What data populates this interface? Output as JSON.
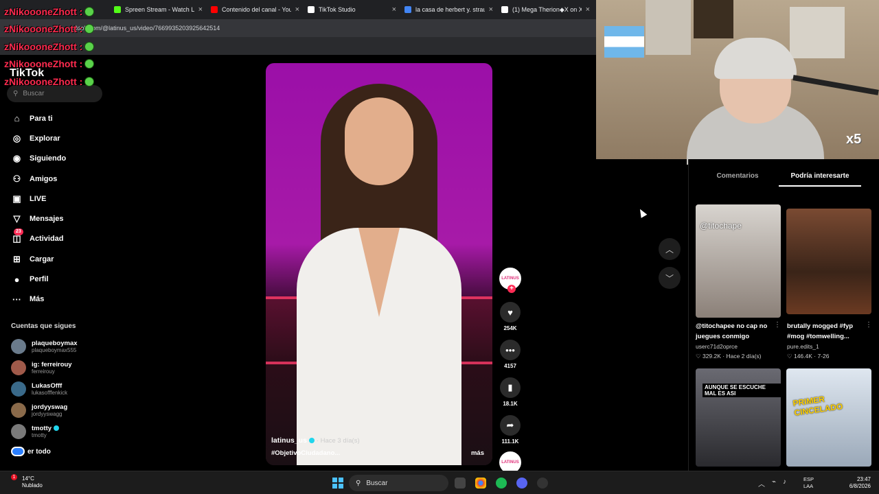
{
  "browser": {
    "tabs": [
      {
        "title": "Spreen Stream - Watch Li",
        "color": "#53fc18"
      },
      {
        "title": "Contenido del canal - You",
        "color": "#ff0000"
      },
      {
        "title": "TikTok Studio",
        "color": "#ffffff"
      },
      {
        "title": "la casa de herbert y. straus",
        "color": "#4285f4"
      },
      {
        "title": "(1) Mega Therion◆X on X",
        "color": "#ffffff"
      }
    ],
    "url": "tiktok.com/@latinus_us/video/7669935203925642514"
  },
  "chat_overlay": {
    "username": "zNikoooneZhott",
    "lines": [
      "zNikoooneZhott :",
      "zNikoooneZhott :",
      "zNikoooneZhott :",
      "zNikoooneZhott :",
      "zNikoooneZhott :"
    ]
  },
  "sidebar": {
    "logo": "TikTok",
    "search_placeholder": "Buscar",
    "nav": [
      {
        "label": "Para ti",
        "icon": "home-icon",
        "glyph": "⌂"
      },
      {
        "label": "Explorar",
        "icon": "compass-icon",
        "glyph": "◎"
      },
      {
        "label": "Siguiendo",
        "icon": "following-icon",
        "glyph": "◉"
      },
      {
        "label": "Amigos",
        "icon": "friends-icon",
        "glyph": "⚇"
      },
      {
        "label": "LIVE",
        "icon": "live-icon",
        "glyph": "▣"
      },
      {
        "label": "Mensajes",
        "icon": "messages-icon",
        "glyph": "▽"
      },
      {
        "label": "Actividad",
        "icon": "activity-icon",
        "glyph": "◫",
        "badge": "23"
      },
      {
        "label": "Cargar",
        "icon": "upload-icon",
        "glyph": "⊞"
      },
      {
        "label": "Perfil",
        "icon": "profile-icon",
        "glyph": "●"
      },
      {
        "label": "Más",
        "icon": "more-icon",
        "glyph": "···"
      }
    ],
    "follows_title": "Cuentas que sigues",
    "follows": [
      {
        "name": "plaqueboymax",
        "handle": "plaqueboymax555"
      },
      {
        "name": "ig: ferreirouy",
        "handle": "ferreirouy"
      },
      {
        "name": "LukasOfff",
        "handle": "lukasofffenkick"
      },
      {
        "name": "jordyyswag",
        "handle": "jordyyswagg"
      },
      {
        "name": "tmotty",
        "handle": "tmotty",
        "verified": true
      }
    ],
    "see_all": "er todo"
  },
  "video": {
    "author": "latinus_us",
    "time": "· Hace 3 día(s)",
    "tag": "#ObjetivoCiudadano...",
    "more": "más",
    "avatar_text": "LATINUS",
    "likes": "254K",
    "comments": "4157",
    "saves": "18.1K",
    "shares": "111.1K"
  },
  "right_panel": {
    "tabs": [
      "Comentarios",
      "Podría interesarte"
    ],
    "active_tab": 1,
    "cards": [
      {
        "title": "@titochapee no cap no juegues conmigo",
        "user": "userc71d2oprce",
        "meta": "♡ 329.2K · Hace 2 día(s)",
        "overlay": "@titochape"
      },
      {
        "title": "brutally mogged #fyp #mog #tomwelling...",
        "user": "pure.edits_1",
        "meta": "♡ 146.4K · 7-26",
        "overlay": ""
      },
      {
        "title": "",
        "user": "",
        "meta": "",
        "overlay": "AUNQUE SE ESCUCHE MAL ES ASI"
      },
      {
        "title": "",
        "user": "",
        "meta": "",
        "overlay": "PRIMER CINCELADO"
      }
    ]
  },
  "webcam": {
    "overlay_count": "x5"
  },
  "taskbar": {
    "temp": "14°C",
    "weather": "Nublado",
    "alert": "1",
    "search": "Buscar",
    "lang1": "ESP",
    "lang2": "LAA",
    "time": "23:47",
    "date": "6/8/2026"
  }
}
